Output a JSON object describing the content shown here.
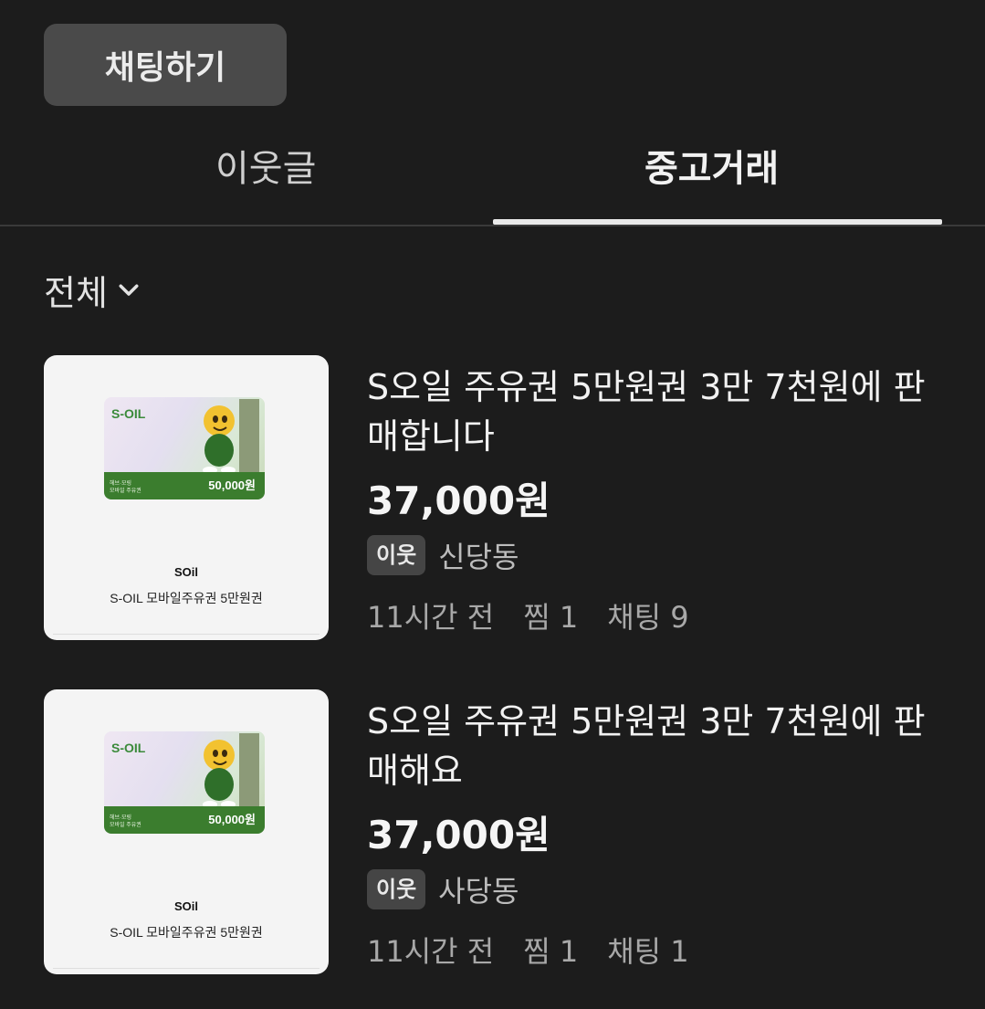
{
  "chat_button": {
    "label": "채팅하기"
  },
  "tabs": [
    {
      "label": "이웃글",
      "active": false
    },
    {
      "label": "중고거래",
      "active": true
    }
  ],
  "filter": {
    "label": "전체"
  },
  "items": [
    {
      "title": "S오일 주유권 5만원권 3만 7천원에 판매합니다",
      "price": "37,000원",
      "badge": "이웃",
      "location": "신당동",
      "time": "11시간 전",
      "likes": "찜 1",
      "chats": "채팅 9",
      "thumb": {
        "logo": "S-OIL",
        "card_small_1": "헤브·모링",
        "card_small_2": "모바일 주유권",
        "amount": "50,000원",
        "brand": "SOil",
        "desc": "S-OIL 모바일주유권 5만원권"
      }
    },
    {
      "title": "S오일 주유권 5만원권 3만 7천원에 판매해요",
      "price": "37,000원",
      "badge": "이웃",
      "location": "사당동",
      "time": "11시간 전",
      "likes": "찜 1",
      "chats": "채팅 1",
      "thumb": {
        "logo": "S-OIL",
        "card_small_1": "헤브·모링",
        "card_small_2": "모바일 주유권",
        "amount": "50,000원",
        "brand": "SOil",
        "desc": "S-OIL 모바일주유권 5만원권"
      }
    }
  ],
  "colors": {
    "background": "#1c1c1c",
    "button": "#4a4a4a",
    "card_green": "#3b7d2e",
    "badge": "#454545"
  }
}
